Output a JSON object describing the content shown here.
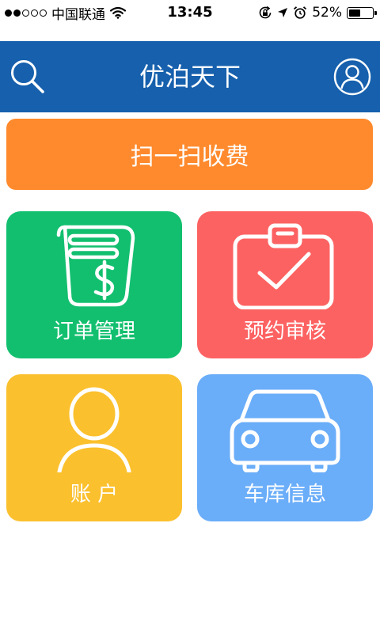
{
  "status_bar": {
    "carrier": "中国联通",
    "time": "13:45",
    "battery_percent": "52%",
    "battery_level": 0.52,
    "signal_bars_filled": 2,
    "signal_bars_total": 5
  },
  "nav": {
    "title": "优泊天下",
    "left_icon": "search-icon",
    "right_icon": "user-avatar-icon",
    "background_color": "#1660ad"
  },
  "scan_button": {
    "label": "扫一扫收费",
    "color": "#ff8a2d"
  },
  "tiles": [
    {
      "id": "orders",
      "label": "订单管理",
      "icon": "receipt-dollar-icon",
      "color": "#12bf6f"
    },
    {
      "id": "reservation",
      "label": "预约审核",
      "icon": "clipboard-check-icon",
      "color": "#fd6262"
    },
    {
      "id": "account",
      "label": "账 户",
      "icon": "person-icon",
      "color": "#fbc02d"
    },
    {
      "id": "garage",
      "label": "车库信息",
      "icon": "car-icon",
      "color": "#6aadf9"
    }
  ]
}
